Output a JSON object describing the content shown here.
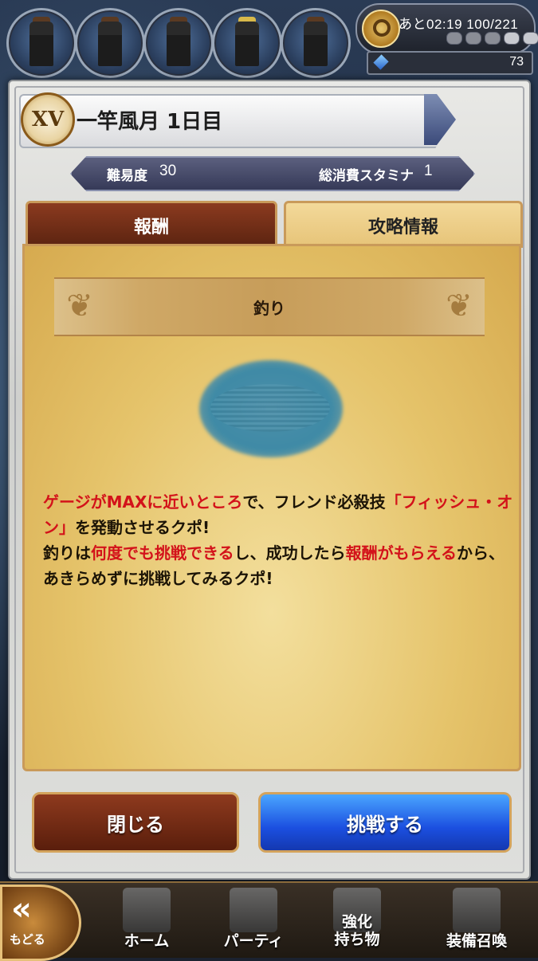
{
  "status": {
    "stamina_timer": "あと02:19",
    "stamina_value": "100/221",
    "gems": "73"
  },
  "modal": {
    "rank_badge": "XV",
    "title": "一竿風月 1日目",
    "difficulty_label": "難易度",
    "difficulty_value": "30",
    "stamina_cost_label": "総消費スタミナ",
    "stamina_cost_value": "1",
    "tabs": {
      "reward": "報酬",
      "strategy": "攻略情報"
    },
    "section_title": "釣り",
    "description": {
      "p1_red1": "ゲージがMAXに近いところ",
      "p1_t1": "で、フレンド必殺技",
      "p1_red2": "「フィッシュ・オン」",
      "p1_t2": "を発動させるクポ!",
      "p2_t1": "釣りは",
      "p2_red1": "何度でも挑戦できる",
      "p2_t2": "し、成功したら",
      "p2_red2": "報酬がもらえる",
      "p2_t3": "から、あきらめずに挑戦してみるクポ!"
    },
    "buttons": {
      "close": "閉じる",
      "challenge": "挑戦する"
    }
  },
  "nav": {
    "back": "もどる",
    "home": "ホーム",
    "party": "パーティ",
    "enhance_line1": "強化",
    "enhance_line2": "持ち物",
    "summon": "装備召喚"
  },
  "colors": {
    "accent_red": "#d3121a",
    "challenge_blue": "#1b4fe0",
    "close_brown": "#5a1e0c",
    "parchment": "#e5c36a"
  }
}
